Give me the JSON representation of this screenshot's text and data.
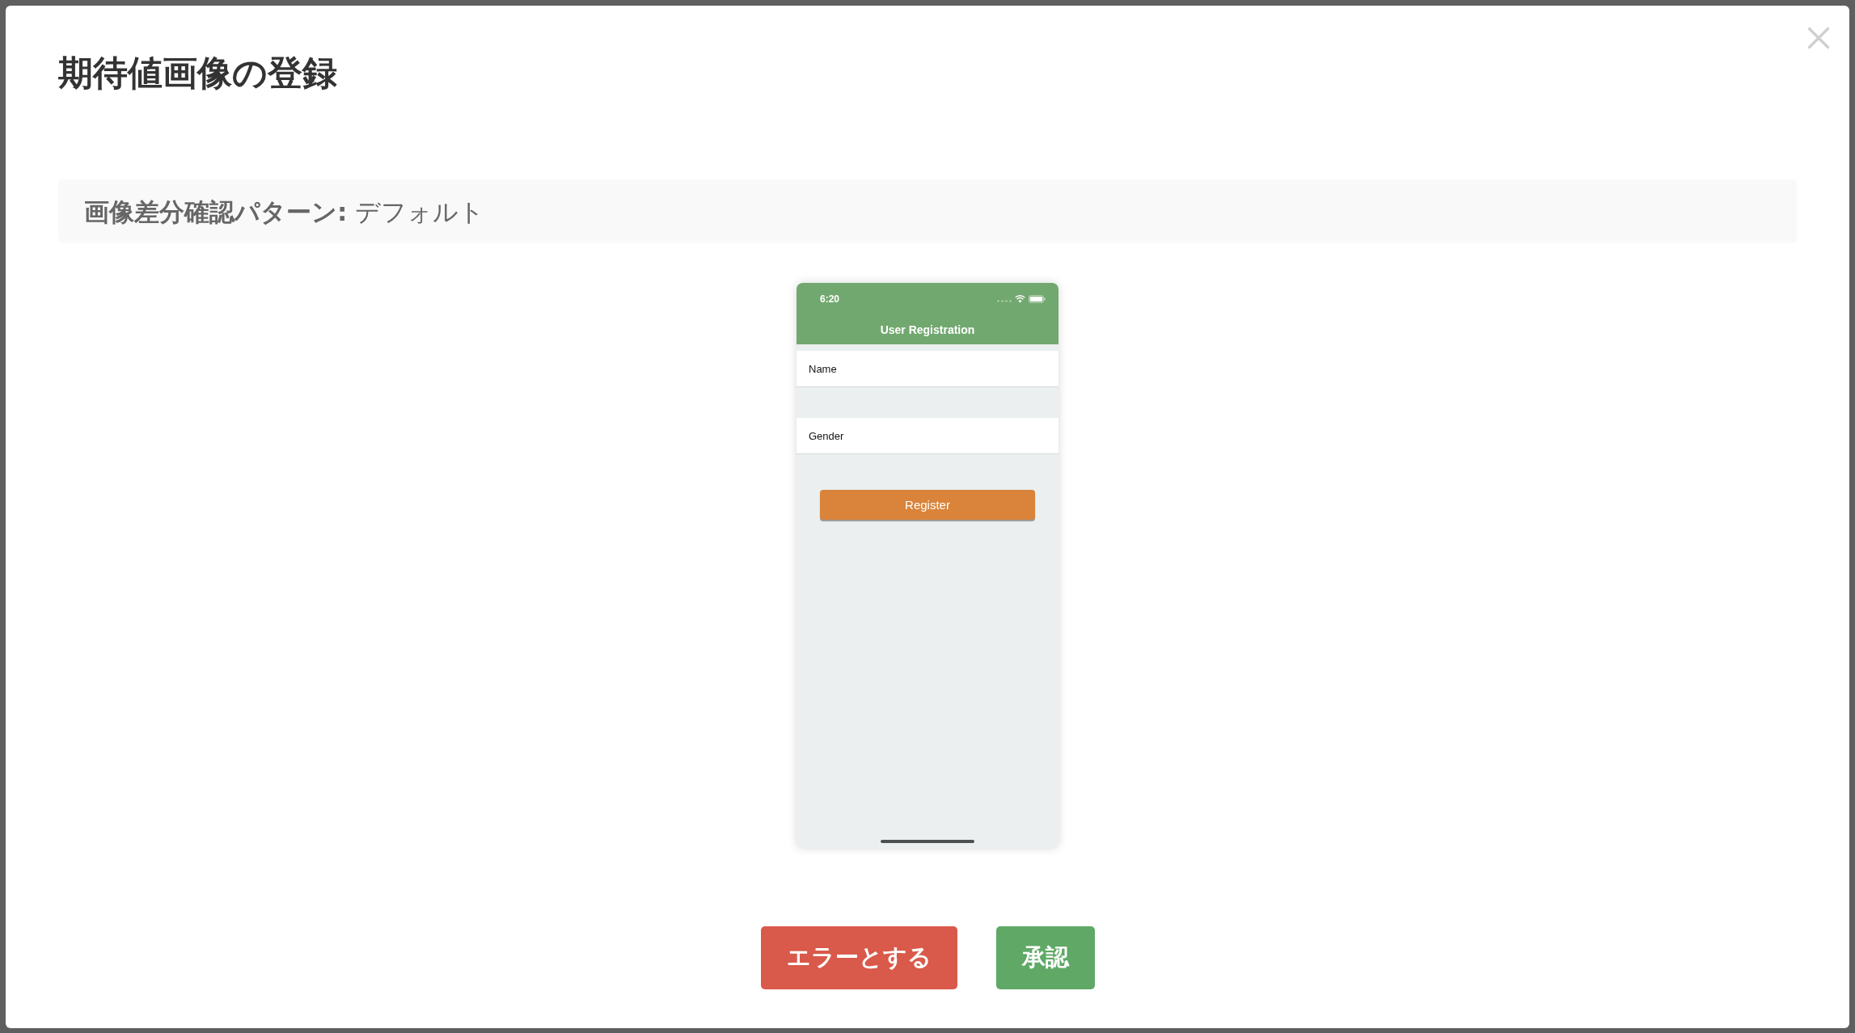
{
  "dialog": {
    "title": "期待値画像の登録"
  },
  "diff_pattern": {
    "label": "画像差分確認パターン:",
    "value": "デフォルト"
  },
  "expected_image": {
    "status_bar": {
      "time": "6:20"
    },
    "nav_title": "User Registration",
    "fields": [
      {
        "label": "Name"
      },
      {
        "label": "Gender"
      }
    ],
    "button": "Register"
  },
  "actions": [
    {
      "label": "エラーとする",
      "kind": "danger"
    },
    {
      "label": "承認",
      "kind": "approve"
    }
  ]
}
